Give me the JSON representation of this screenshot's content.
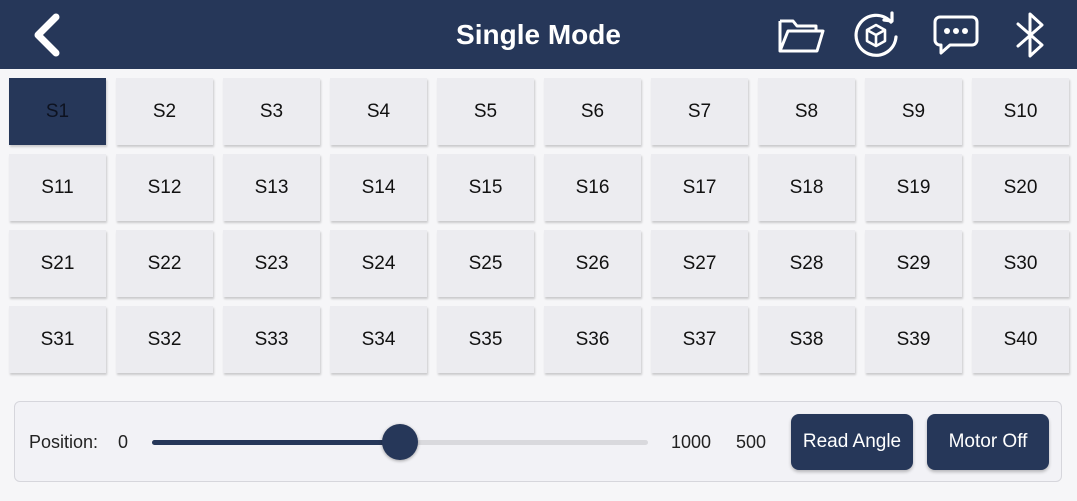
{
  "header": {
    "title": "Single Mode",
    "icons": [
      "back-arrow-icon",
      "folder-icon",
      "reset-cube-icon",
      "chat-icon",
      "bluetooth-icon"
    ]
  },
  "servos": {
    "selected": "S1",
    "items": [
      "S1",
      "S2",
      "S3",
      "S4",
      "S5",
      "S6",
      "S7",
      "S8",
      "S9",
      "S10",
      "S11",
      "S12",
      "S13",
      "S14",
      "S15",
      "S16",
      "S17",
      "S18",
      "S19",
      "S20",
      "S21",
      "S22",
      "S23",
      "S24",
      "S25",
      "S26",
      "S27",
      "S28",
      "S29",
      "S30",
      "S31",
      "S32",
      "S33",
      "S34",
      "S35",
      "S36",
      "S37",
      "S38",
      "S39",
      "S40"
    ]
  },
  "position": {
    "label": "Position:",
    "min": "0",
    "max": "1000",
    "value": "500"
  },
  "buttons": {
    "read_angle": "Read Angle",
    "motor_off": "Motor Off"
  },
  "colors": {
    "primary": "#263759",
    "tile": "#ececf0",
    "background": "#f6f6f8"
  }
}
